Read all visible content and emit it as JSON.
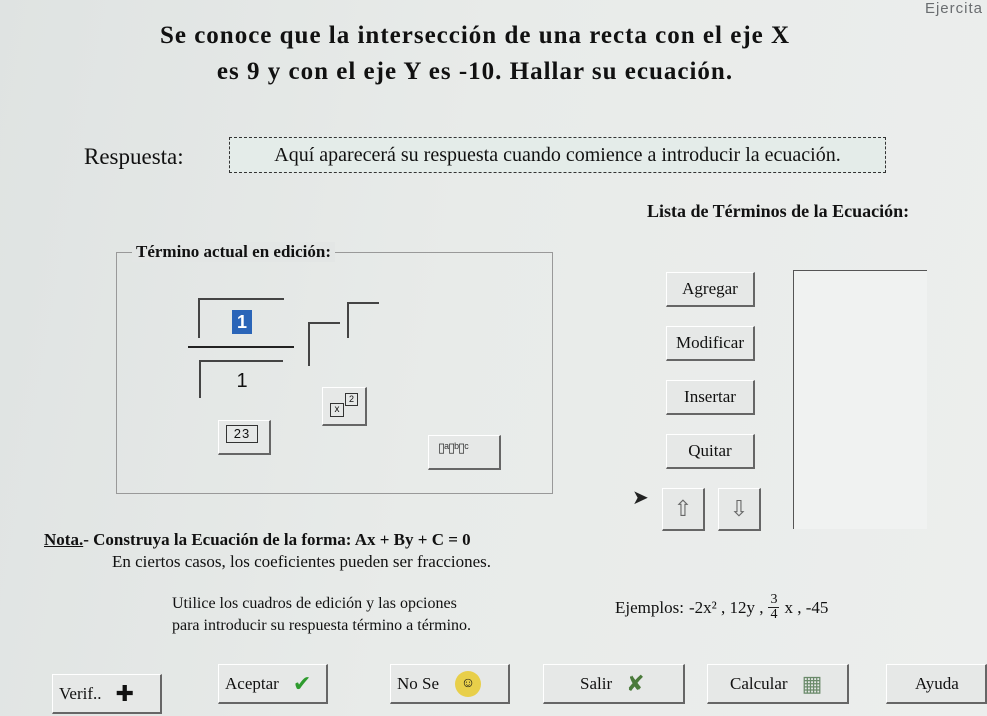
{
  "header": {
    "corner_label": "Ejercita",
    "question_line1": "Se conoce  que  la intersección  de  una recta con el eje  X",
    "question_line2": "es 9 y con el eje Y es -10.  Hallar  su  ecuación."
  },
  "answer": {
    "label": "Respuesta:",
    "placeholder": "Aquí aparecerá su respuesta cuando comience a introducir la ecuación."
  },
  "term_list": {
    "title": "Lista de Términos de la Ecuación:",
    "buttons": [
      "Agregar",
      "Modificar",
      "Insertar",
      "Quitar"
    ],
    "up_icon": "up-arrow-icon",
    "down_icon": "down-arrow-icon"
  },
  "editor": {
    "legend": "Término actual en edición:",
    "numerator_value": "1",
    "denominator_value": "1",
    "power_base_glyph": "x",
    "power_exp_glyph": "2",
    "number_button_text": "23",
    "multi_term_glyph": "▯ᵃ▯ᵇ▯ᶜ"
  },
  "notes": {
    "nota_prefix": "Nota.",
    "nota_text": "- Construya la Ecuación de la forma: Ax + By + C = 0",
    "casos": "En ciertos casos, los coeficientes pueden ser fracciones.",
    "utilice1": "Utilice los cuadros de edición y las opciones",
    "utilice2": "para introducir su respuesta término a término.",
    "ejemplos_label": "Ejemplos:",
    "ej1": "-2x² , 12y ,",
    "ej_frac_num": "3",
    "ej_frac_den": "4",
    "ej2": "x , -45"
  },
  "bottom_bar": {
    "verif": "Verif..",
    "aceptar": "Aceptar",
    "no_se": "No Se",
    "salir": "Salir",
    "calcular": "Calcular",
    "ayuda": "Ayuda"
  },
  "colors": {
    "accent_cursor": "#2a65b8",
    "check_green": "#2e9b2e"
  }
}
